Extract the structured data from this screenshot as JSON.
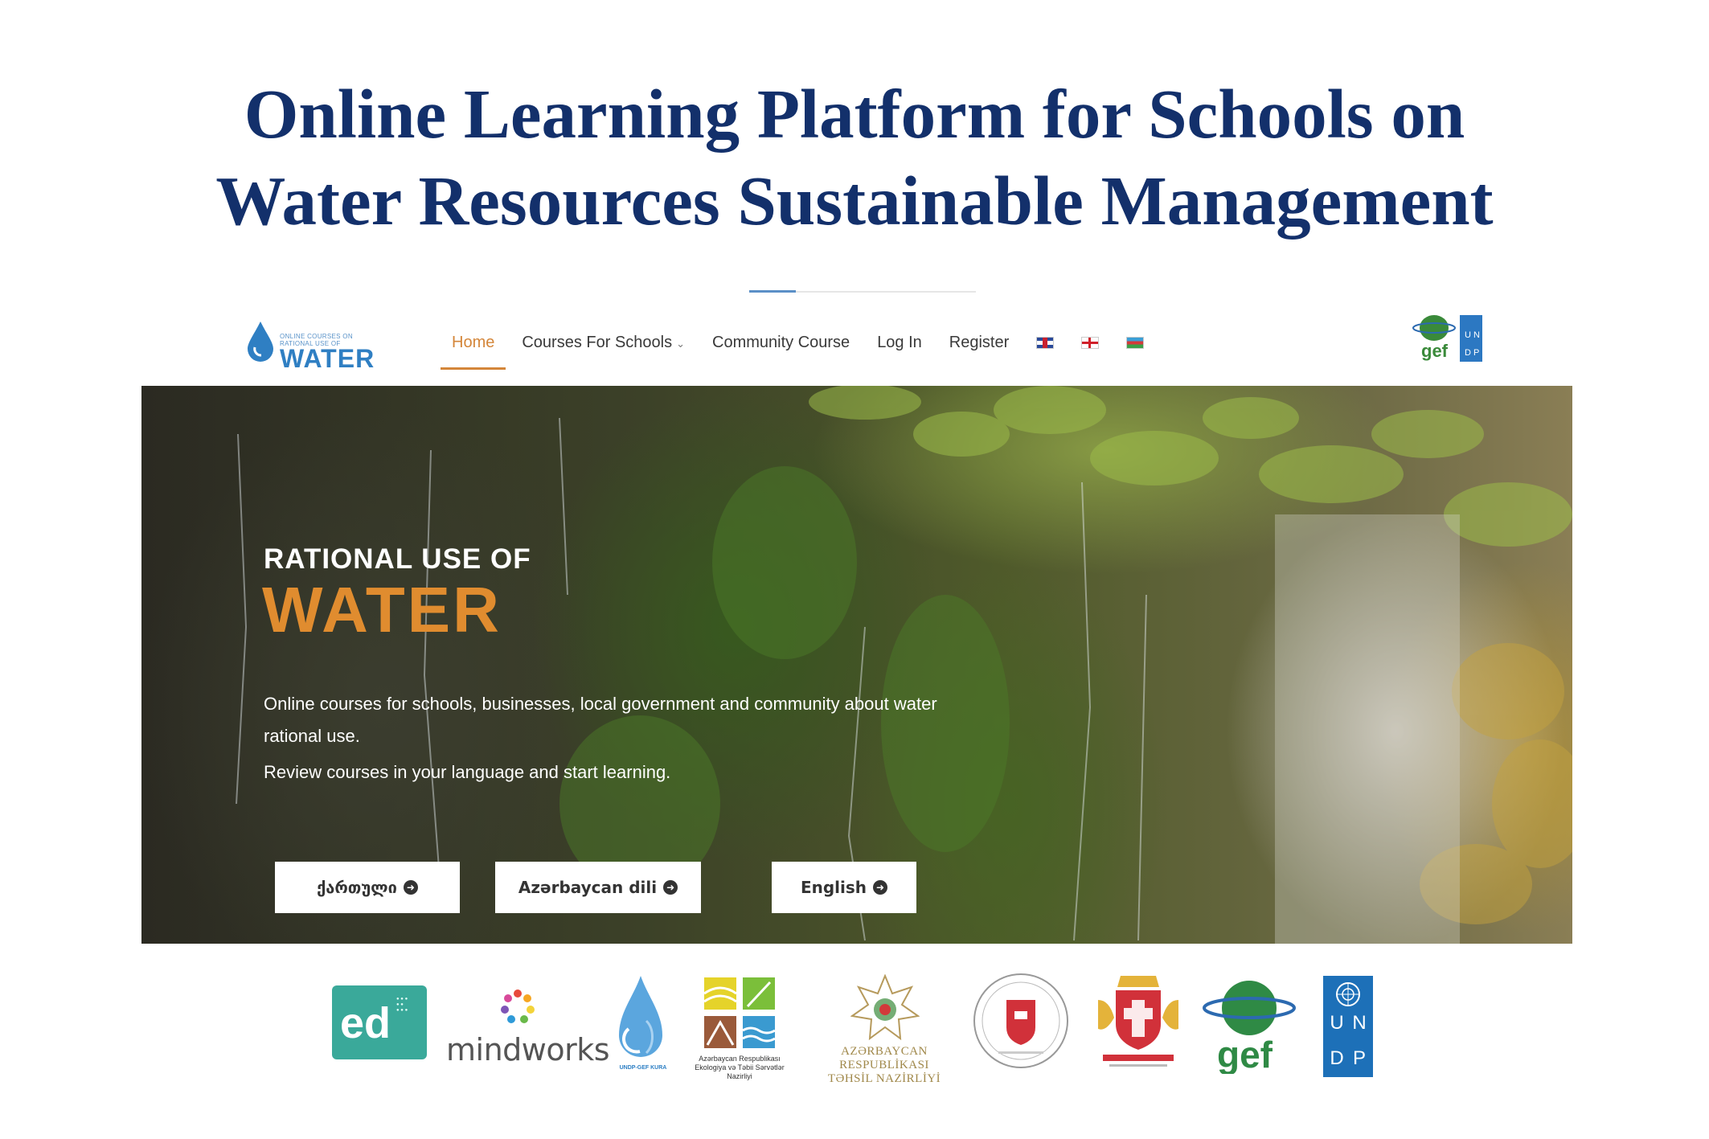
{
  "slide": {
    "title_line1": "Online Learning Platform for Schools on",
    "title_line2": "Water Resources Sustainable Management"
  },
  "site": {
    "logo": {
      "small_line1": "ONLINE COURSES ON",
      "small_line2": "RATIONAL USE OF",
      "big": "WATER",
      "icon": "water-drop-icon"
    },
    "nav": {
      "items": [
        {
          "label": "Home",
          "active": true
        },
        {
          "label": "Courses For Schools",
          "has_dropdown": true
        },
        {
          "label": "Community Course"
        },
        {
          "label": "Log In"
        },
        {
          "label": "Register"
        }
      ],
      "flags": [
        "uk-flag-icon",
        "georgia-flag-icon",
        "azerbaijan-flag-icon"
      ],
      "partner_logos": {
        "gef": "gef",
        "undp": [
          "U",
          "N",
          "D",
          "P"
        ]
      }
    },
    "hero": {
      "heading_small": "RATIONAL USE OF",
      "heading_big": "WATER",
      "description": "Online courses for schools, businesses, local government and community about water rational use.",
      "description2": "Review courses in your  language and start learning.",
      "buttons": [
        {
          "label": "ქართული"
        },
        {
          "label": "Azərbaycan dili"
        },
        {
          "label": "English"
        }
      ]
    }
  },
  "partners": {
    "ed": {
      "text": "ed"
    },
    "mindworks": {
      "text": "mindworks"
    },
    "undp_gef_kura": {
      "text": "UNDP-GEF KURA"
    },
    "eco_ministry": {
      "text": "Azərbaycan Respublikası Ekologiya və Təbii Sərvətlər Nazirliyi"
    },
    "education_ministry": {
      "line1": "AZƏRBAYCAN RESPUBLİKASI",
      "line2": "TƏHSİL NAZİRLİYİ"
    },
    "gef": {
      "text": "gef"
    },
    "undp": {
      "letters": [
        "U",
        "N",
        "D",
        "P"
      ]
    }
  },
  "colors": {
    "title": "#13306b",
    "accent_orange": "#e08c2f",
    "nav_active": "#d4863a",
    "logo_blue": "#2f7fc3",
    "undp_blue": "#1d70b8",
    "ed_green": "#3aa99a"
  }
}
